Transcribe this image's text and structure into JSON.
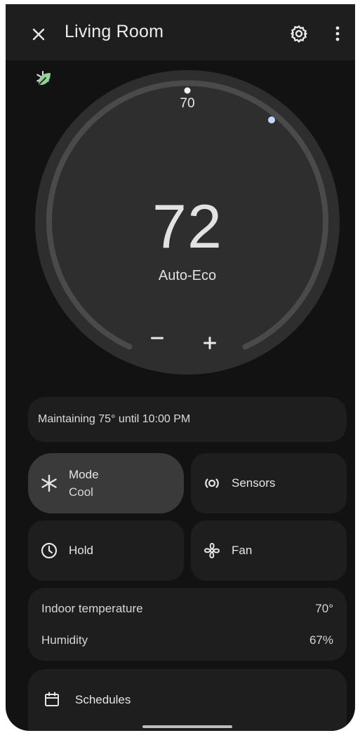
{
  "header": {
    "title": "Living Room",
    "close_icon": "close-icon",
    "settings_icon": "gear-icon",
    "more_icon": "more-vert-icon"
  },
  "thermostat": {
    "setpoint": "70",
    "current_temp": "72",
    "mode": "Auto-Eco",
    "minus_label": "−",
    "plus_label": "+",
    "eco_icon": "leaf-icon",
    "cool_icon": "snowflake-icon",
    "colors": {
      "eco": "#8fd694",
      "cool_marker": "#c4d8ff",
      "arc": "#4a4a4a"
    }
  },
  "status": {
    "text": "Maintaining 75° until 10:00 PM"
  },
  "controls": {
    "mode": {
      "label": "Mode",
      "value": "Cool",
      "icon": "snowflake-icon"
    },
    "sensors": {
      "label": "Sensors",
      "icon": "sensors-icon"
    },
    "hold": {
      "label": "Hold",
      "icon": "clock-icon"
    },
    "fan": {
      "label": "Fan",
      "icon": "fan-icon"
    }
  },
  "readings": [
    {
      "label": "Indoor temperature",
      "value": "70°"
    },
    {
      "label": "Humidity",
      "value": "67%"
    }
  ],
  "schedules": {
    "label": "Schedules",
    "icon": "calendar-icon"
  }
}
